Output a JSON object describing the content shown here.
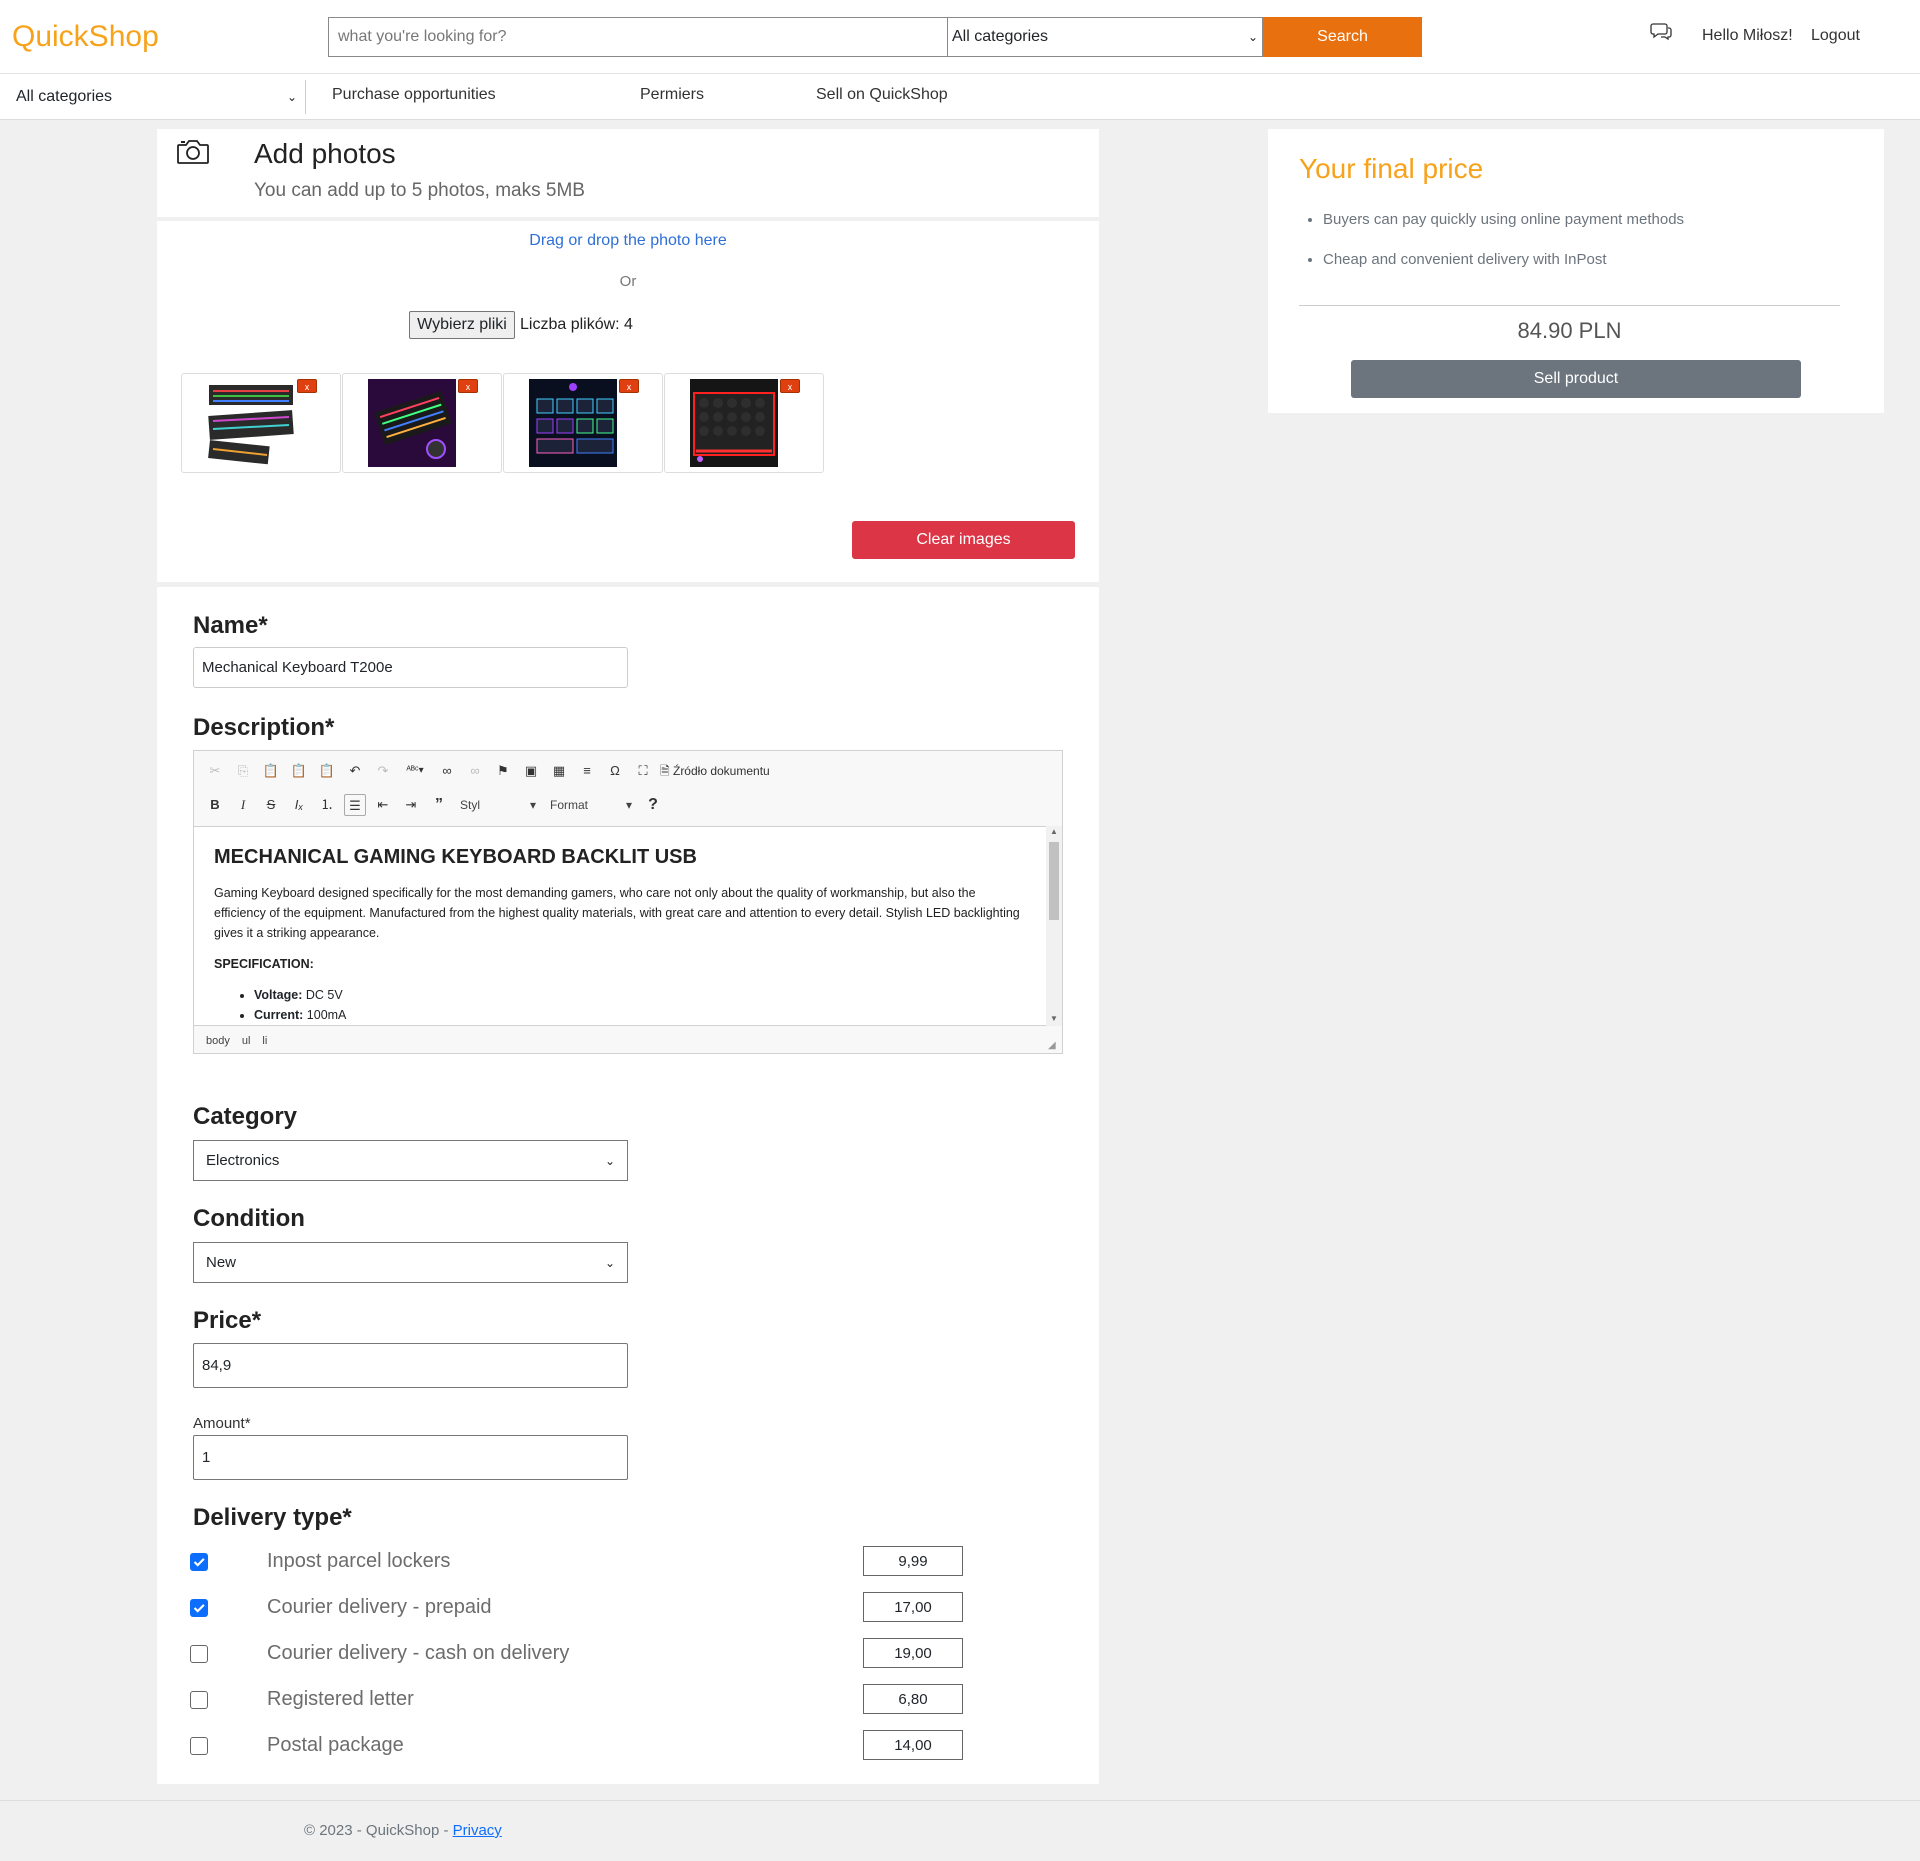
{
  "header": {
    "logo": "QuickShop",
    "search_placeholder": "what you're looking for?",
    "category_select": "All categories",
    "search_button": "Search",
    "greeting": "Hello Miłosz!",
    "logout": "Logout"
  },
  "nav": {
    "category_select": "All categories",
    "links": [
      "Purchase opportunities",
      "Permiers",
      "Sell on QuickShop"
    ]
  },
  "photos": {
    "title": "Add photos",
    "subtitle": "You can add up to 5 photos, maks 5MB",
    "drop_text": "Drag or drop the photo here",
    "or_text": "Or",
    "file_button": "Wybierz pliki",
    "file_count": "Liczba plików: 4",
    "remove_label": "x",
    "thumbnails": [
      "keyboard-1",
      "keyboard-2",
      "keyboard-3",
      "keyboard-4"
    ],
    "clear_button": "Clear images"
  },
  "form": {
    "name_label": "Name*",
    "name_value": "Mechanical Keyboard T200e",
    "description_label": "Description*",
    "editor": {
      "source_label": "Źródło dokumentu",
      "style_select": "Styl",
      "format_select": "Format",
      "heading": "MECHANICAL GAMING KEYBOARD BACKLIT USB",
      "paragraph": "Gaming Keyboard designed specifically for the most demanding gamers, who care not only about the quality of workmanship, but also the efficiency of the equipment. Manufactured from the highest quality materials, with great care and attention to every detail. Stylish LED backlighting gives it a striking appearance.",
      "spec_heading": "SPECIFICATION:",
      "spec_items": [
        {
          "key": "Voltage:",
          "value": " DC 5V"
        },
        {
          "key": "Current:",
          "value": " 100mA"
        }
      ],
      "path": [
        "body",
        "ul",
        "li"
      ]
    },
    "category_label": "Category",
    "category_value": "Electronics",
    "condition_label": "Condition",
    "condition_value": "New",
    "price_label": "Price*",
    "price_value": "84,9",
    "amount_label": "Amount*",
    "amount_value": "1",
    "delivery_label": "Delivery type*",
    "delivery": [
      {
        "label": "Inpost parcel lockers",
        "checked": true,
        "fee": "9,99"
      },
      {
        "label": "Courier delivery - prepaid",
        "checked": true,
        "fee": "17,00"
      },
      {
        "label": "Courier delivery - cash on delivery",
        "checked": false,
        "fee": "19,00"
      },
      {
        "label": "Registered letter",
        "checked": false,
        "fee": "6,80"
      },
      {
        "label": "Postal package",
        "checked": false,
        "fee": "14,00"
      }
    ]
  },
  "summary": {
    "title": "Your final price",
    "bullets": [
      "Buyers can pay quickly using online payment methods",
      "Cheap and convenient delivery with InPost"
    ],
    "price": "84.90 PLN",
    "sell_button": "Sell product"
  },
  "footer": {
    "copyright": "© 2023 - QuickShop - ",
    "privacy": "Privacy"
  },
  "colors": {
    "brand": "#f7a21b",
    "search_button": "#e8700e",
    "danger": "#dc3545",
    "sell_button": "#6c757d",
    "link": "#0d6efd"
  }
}
